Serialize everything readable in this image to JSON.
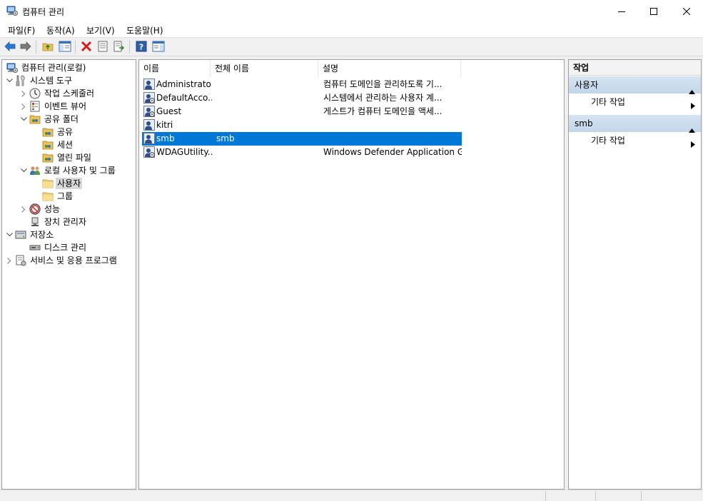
{
  "window": {
    "title": "컴퓨터 관리",
    "icon": "computer-management-icon",
    "controls": [
      "minimize-icon",
      "maximize-icon",
      "close-icon"
    ]
  },
  "menu": [
    {
      "label": "파일(F)"
    },
    {
      "label": "동작(A)"
    },
    {
      "label": "보기(V)"
    },
    {
      "label": "도움말(H)"
    }
  ],
  "toolbar": {
    "buttons": [
      "back-arrow-icon",
      "forward-arrow-icon",
      "up-folder-icon",
      "show-hide-tree-icon",
      "delete-icon",
      "properties-icon",
      "export-list-icon",
      "help-icon",
      "show-hide-action-pane-icon"
    ]
  },
  "tree": {
    "items": [
      {
        "label": "컴퓨터 관리(로컬)",
        "icon": "computer-management-icon",
        "expander": "",
        "level": 0
      },
      {
        "label": "시스템 도구",
        "icon": "system-tools-icon",
        "expander": "expanded",
        "level": 0
      },
      {
        "label": "작업 스케줄러",
        "icon": "clock-icon",
        "expander": "collapsed",
        "level": 1
      },
      {
        "label": "이벤트 뷰어",
        "icon": "event-viewer-icon",
        "expander": "collapsed",
        "level": 1
      },
      {
        "label": "공유 폴더",
        "icon": "shared-folder-icon",
        "expander": "expanded",
        "level": 1
      },
      {
        "label": "공유",
        "icon": "shared-folder-icon",
        "expander": "",
        "level": 2
      },
      {
        "label": "세션",
        "icon": "shared-folder-icon",
        "expander": "",
        "level": 2
      },
      {
        "label": "열린 파일",
        "icon": "shared-folder-icon",
        "expander": "",
        "level": 2
      },
      {
        "label": "로컬 사용자 및 그룹",
        "icon": "local-users-groups-icon",
        "expander": "expanded",
        "level": 1
      },
      {
        "label": "사용자",
        "icon": "folder-icon",
        "expander": "",
        "level": 2,
        "selected": true
      },
      {
        "label": "그룹",
        "icon": "folder-icon",
        "expander": "",
        "level": 2
      },
      {
        "label": "성능",
        "icon": "performance-icon",
        "expander": "collapsed",
        "level": 1
      },
      {
        "label": "장치 관리자",
        "icon": "device-manager-icon",
        "expander": "",
        "level": 1
      },
      {
        "label": "저장소",
        "icon": "storage-icon",
        "expander": "expanded",
        "level": 0
      },
      {
        "label": "디스크 관리",
        "icon": "disk-management-icon",
        "expander": "",
        "level": 1
      },
      {
        "label": "서비스 및 응용 프로그램",
        "icon": "services-apps-icon",
        "expander": "collapsed",
        "level": 0
      }
    ]
  },
  "list": {
    "columns": [
      "이름",
      "전체 이름",
      "설명"
    ],
    "rows": [
      {
        "name": "Administrator",
        "full_name": "",
        "description": "컴퓨터 도메인을 관리하도록 기...",
        "icon": "user-icon"
      },
      {
        "name": "DefaultAcco...",
        "full_name": "",
        "description": "시스템에서 관리하는 사용자 계...",
        "icon": "user-disabled-icon"
      },
      {
        "name": "Guest",
        "full_name": "",
        "description": "게스트가 컴퓨터 도메인을 액세...",
        "icon": "user-disabled-icon"
      },
      {
        "name": "kitri",
        "full_name": "",
        "description": "",
        "icon": "user-icon"
      },
      {
        "name": "smb",
        "full_name": "smb",
        "description": "",
        "icon": "user-icon",
        "selected": true
      },
      {
        "name": "WDAGUtility...",
        "full_name": "",
        "description": "Windows Defender Application G...",
        "icon": "user-disabled-icon"
      }
    ]
  },
  "actions": {
    "title": "작업",
    "sections": [
      {
        "header": "사용자",
        "items": [
          {
            "label": "기타 작업"
          }
        ]
      },
      {
        "header": "smb",
        "items": [
          {
            "label": "기타 작업"
          }
        ]
      }
    ]
  },
  "colors": {
    "selection": "#0078d7",
    "tree_selection": "#d9d9d9",
    "action_header": "#c8d9ec"
  }
}
